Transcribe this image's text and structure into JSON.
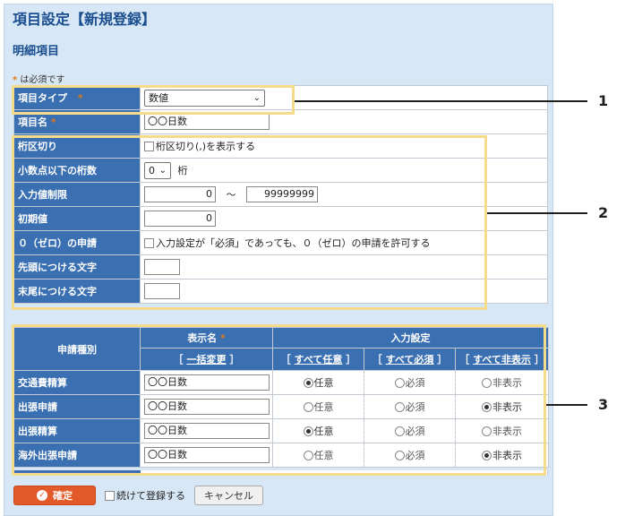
{
  "page": {
    "title": "項目設定【新規登録】",
    "section_title": "明細項目",
    "required_note_mark": "*",
    "required_note_text": "は必須です"
  },
  "form": {
    "item_type_label": "項目タイプ",
    "item_type_value": "数値",
    "item_name_label": "項目名",
    "item_name_value": "〇〇日数",
    "digit_sep_label": "桁区切り",
    "digit_sep_option": "桁区切り(,)を表示する",
    "decimal_label": "小数点以下の桁数",
    "decimal_value": "0",
    "decimal_unit": "桁",
    "limit_label": "入力値制限",
    "limit_min": "0",
    "limit_tilde": "～",
    "limit_max": "99999999",
    "initial_label": "初期値",
    "initial_value": "0",
    "zero_label": "０（ゼロ）の申請",
    "zero_option": "入力設定が「必須」であっても、０（ゼロ）の申請を許可する",
    "prefix_label": "先頭につける文字",
    "suffix_label": "末尾につける文字",
    "required_mark": "*"
  },
  "grid": {
    "col_type": "申請種別",
    "col_display": "表示名",
    "col_display_link": "一括変更",
    "col_input": "入力設定",
    "link_all_optional": "すべて任意",
    "link_all_required": "すべて必須",
    "link_all_hidden": "すべて非表示",
    "opt_optional": "任意",
    "opt_required": "必須",
    "opt_hidden": "非表示",
    "rows": [
      {
        "type": "交通費精算",
        "name": "〇〇日数"
      },
      {
        "type": "出張申請",
        "name": "〇〇日数"
      },
      {
        "type": "出張精算",
        "name": "〇〇日数"
      },
      {
        "type": "海外出張申請",
        "name": "〇〇日数"
      }
    ]
  },
  "callouts": {
    "one": "1",
    "two": "2",
    "three": "3"
  },
  "footer": {
    "confirm": "確定",
    "continue": "続けて登録する",
    "cancel": "キャンセル"
  },
  "colors": {
    "accent": "#3a6fb2",
    "highlight": "#f5dc8c",
    "confirm": "#e35a2a"
  }
}
